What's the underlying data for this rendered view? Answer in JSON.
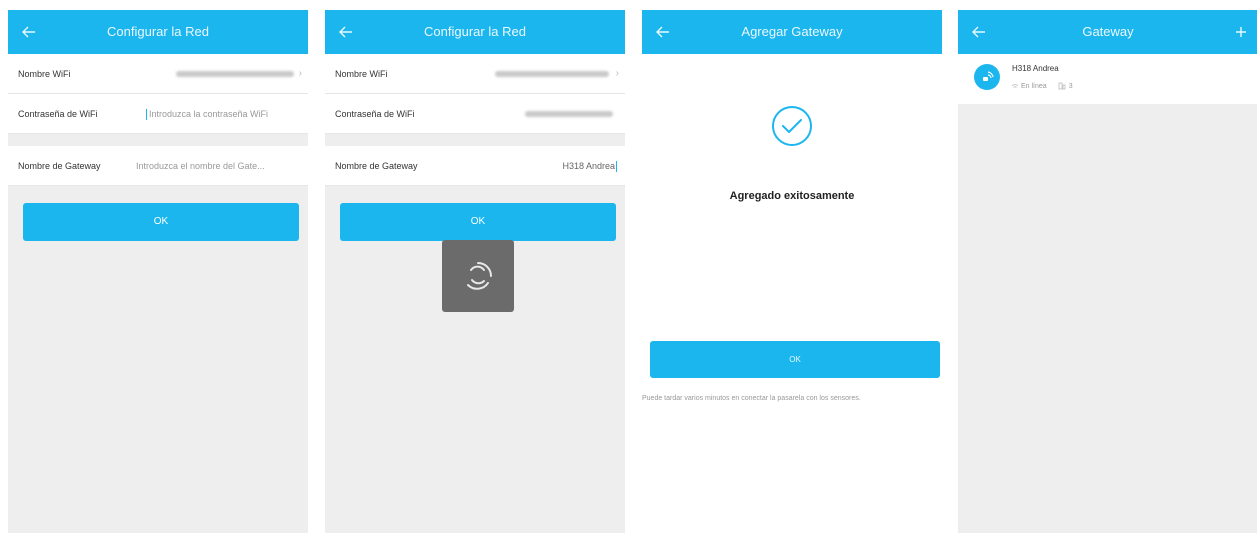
{
  "screens": {
    "network": {
      "title": "Configurar la Red",
      "wifi_label": "Nombre WiFi",
      "password_label": "Contraseña de WiFi",
      "password_placeholder": "Introduzca la contraseña WiFi",
      "gateway_label": "Nombre de Gateway",
      "gateway_placeholder": "Introduzca el nombre del Gate...",
      "ok_label": "OK"
    },
    "network_filled": {
      "title": "Configurar la Red",
      "wifi_label": "Nombre WiFi",
      "password_label": "Contraseña de WiFi",
      "gateway_label": "Nombre de Gateway",
      "gateway_value": "H318 Andrea",
      "ok_label": "OK"
    },
    "add_gateway": {
      "title": "Agregar Gateway",
      "success_text": "Agregado exitosamente",
      "ok_label": "OK",
      "note": "Puede tardar varios minutos en conectar la pasarela con los sensores."
    },
    "gateway_list": {
      "title": "Gateway",
      "device_name": "H318 Andrea",
      "status": "En línea",
      "device_count": "3"
    }
  },
  "colors": {
    "accent": "#1bb6ee",
    "background": "#eeeeee"
  },
  "icons": {
    "back": "arrow-left",
    "add": "plus",
    "success": "check-circle",
    "loading": "spinner",
    "gateway": "gateway-wave"
  }
}
